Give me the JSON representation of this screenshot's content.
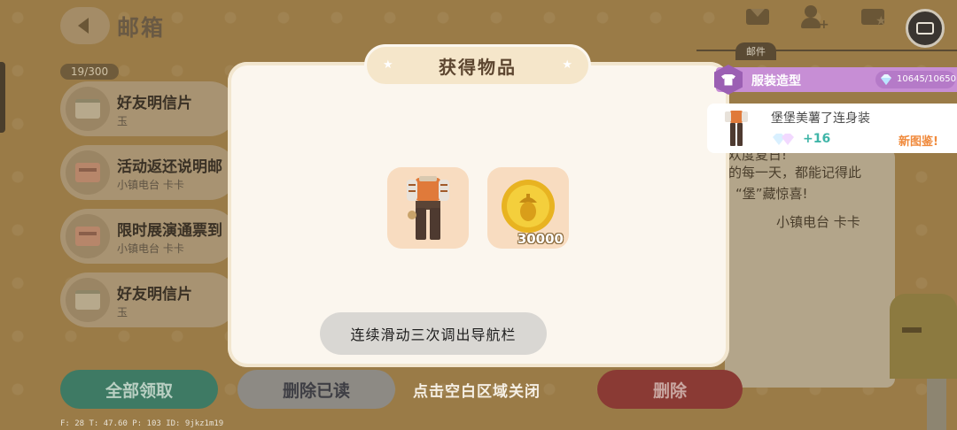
{
  "header": {
    "title": "邮箱",
    "mail_count": "19/300"
  },
  "mail_list": [
    {
      "title": "好友明信片",
      "sender": "玉",
      "icon": "postcard-icon"
    },
    {
      "title": "活动返还说明邮",
      "sender": "小镇电台 卡卡",
      "icon": "envelope-icon"
    },
    {
      "title": "限时展演通票到",
      "sender": "小镇电台 卡卡",
      "icon": "envelope-icon"
    },
    {
      "title": "好友明信片",
      "sender": "玉",
      "icon": "postcard-icon"
    }
  ],
  "bottom_bar": {
    "claim_all": "全部领取",
    "delete_read": "删除已读",
    "tap_close_hint": "点击空白区域关闭",
    "delete": "删除"
  },
  "debug_overlay": "F: 28   T: 47.60   P: 103   ID: 9jkz1m19",
  "right_panel": {
    "mail_tab": "邮件",
    "letter_line0": "欢度夏日!",
    "letter_line1": "的每一天，都能记得此",
    "letter_line2": "“堡”藏惊喜!",
    "letter_signature": "小镇电台 卡卡"
  },
  "reward_popup": {
    "title": "获得物品",
    "items": [
      {
        "name": "outfit",
        "icon": "outfit-icon",
        "quantity": ""
      },
      {
        "name": "coin",
        "icon": "acorn-coin-icon",
        "quantity": "30000"
      }
    ]
  },
  "system_toast": "连续滑动三次调出导航栏",
  "collection_notice": {
    "category": "服装造型",
    "progress": "10645/10650",
    "item_name": "堡堡美薯了连身装",
    "bonus": "+16",
    "new_tag": "新图鉴!"
  },
  "colors": {
    "popup_bg": "#fbf6ee",
    "claim_button": "#3e7a64",
    "delete_button": "#8a3a34",
    "collection_purple": "#c78ed5",
    "bonus_teal": "#3fb5a8",
    "new_tag_orange": "#f08a3c"
  }
}
